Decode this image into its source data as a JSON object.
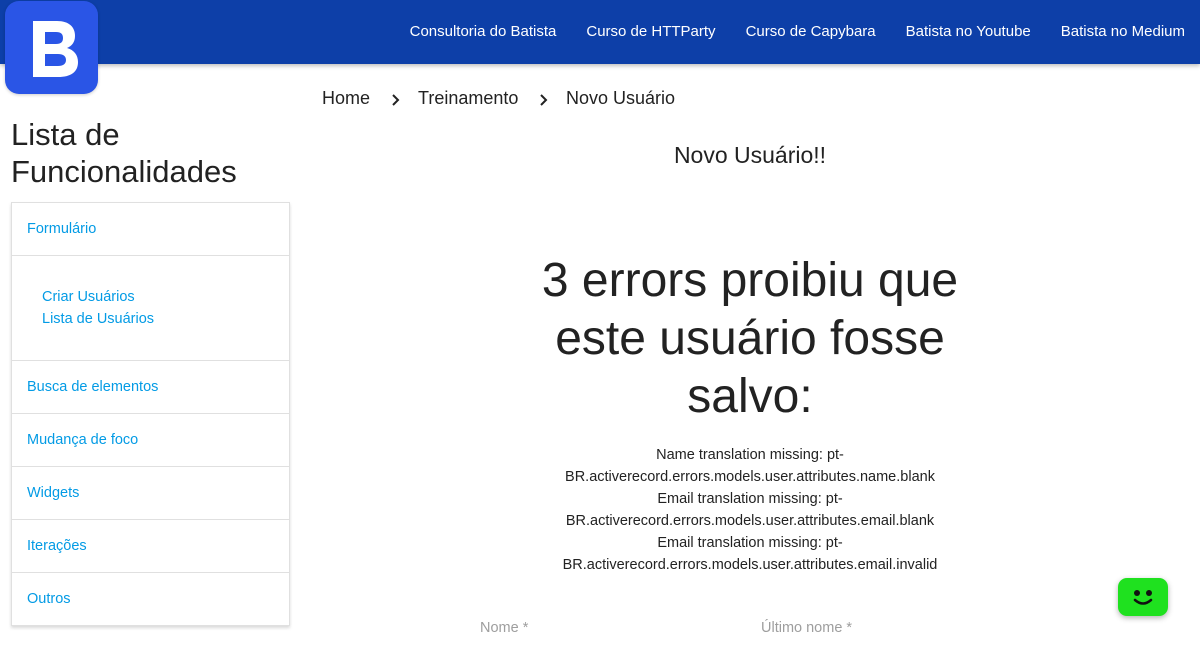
{
  "brand": {
    "logo_letter": "B",
    "color": "#2a55e6",
    "bar_color": "#0d3fa8"
  },
  "nav": {
    "items": [
      "Consultoria do Batista",
      "Curso de HTTParty",
      "Curso de Capybara",
      "Batista no Youtube",
      "Batista no Medium"
    ]
  },
  "sidebar": {
    "title_line1": "Lista de",
    "title_line2": "Funcionalidades",
    "items": {
      "formulario": "Formulário",
      "criar_usuarios": "Criar Usuários",
      "lista_usuarios": "Lista de Usuários",
      "busca": "Busca de elementos",
      "foco": "Mudança de foco",
      "widgets": "Widgets",
      "iteracoes": "Iterações",
      "outros": "Outros"
    },
    "link_color": "#039be5"
  },
  "breadcrumb": [
    "Home",
    "Treinamento",
    "Novo Usuário"
  ],
  "main": {
    "title": "Novo Usuário!!",
    "error_heading": {
      "line1": "3 errors proibiu que",
      "line2": "este usuário fosse",
      "line3": "salvo:"
    },
    "errors": [
      "Name translation missing: pt-",
      "BR.activerecord.errors.models.user.attributes.name.blank",
      "Email translation missing: pt-",
      "BR.activerecord.errors.models.user.attributes.email.blank",
      "Email translation missing: pt-",
      "BR.activerecord.errors.models.user.attributes.email.invalid"
    ],
    "fields": {
      "nome": "Nome *",
      "ultimo_nome": "Último nome *"
    }
  },
  "chat_widget": {
    "icon": "chat-face-icon",
    "color": "#1fe11f"
  }
}
